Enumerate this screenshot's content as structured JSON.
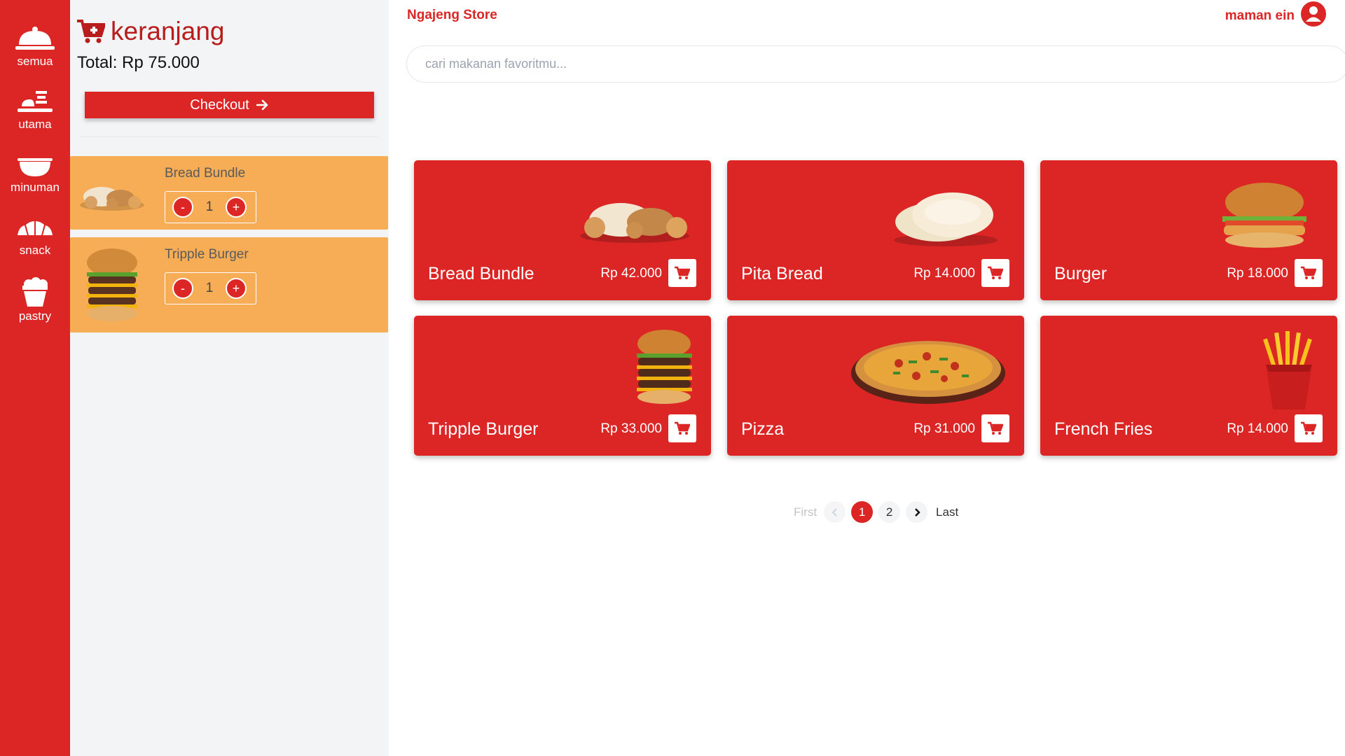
{
  "app": {
    "brand": "Ngajeng Store",
    "user_name": "maman ein"
  },
  "categories": [
    {
      "label": "semua",
      "icon": "cloche-icon"
    },
    {
      "label": "utama",
      "icon": "meal-icon"
    },
    {
      "label": "minuman",
      "icon": "bowl-icon"
    },
    {
      "label": "snack",
      "icon": "croissant-icon"
    },
    {
      "label": "pastry",
      "icon": "cupcake-icon"
    }
  ],
  "cart": {
    "title": "keranjang",
    "total": "Total: Rp 75.000",
    "checkout_label": "Checkout",
    "items": [
      {
        "name": "Bread Bundle",
        "qty": "1",
        "minus": "-",
        "plus": "+"
      },
      {
        "name": "Tripple Burger",
        "qty": "1",
        "minus": "-",
        "plus": "+"
      }
    ]
  },
  "search": {
    "placeholder": "cari makanan favoritmu..."
  },
  "products": [
    {
      "name": "Bread Bundle",
      "price": "Rp 42.000"
    },
    {
      "name": "Pita Bread",
      "price": "Rp 14.000"
    },
    {
      "name": "Burger",
      "price": "Rp 18.000"
    },
    {
      "name": "Tripple Burger",
      "price": "Rp 33.000"
    },
    {
      "name": "Pizza",
      "price": "Rp 31.000"
    },
    {
      "name": "French Fries",
      "price": "Rp 14.000"
    }
  ],
  "pagination": {
    "first": "First",
    "pages": [
      "1",
      "2"
    ],
    "last": "Last",
    "current": "1"
  },
  "colors": {
    "primary": "#dc2626",
    "cart_item_bg": "#f6ad55",
    "panel_bg": "#f3f4f6"
  }
}
